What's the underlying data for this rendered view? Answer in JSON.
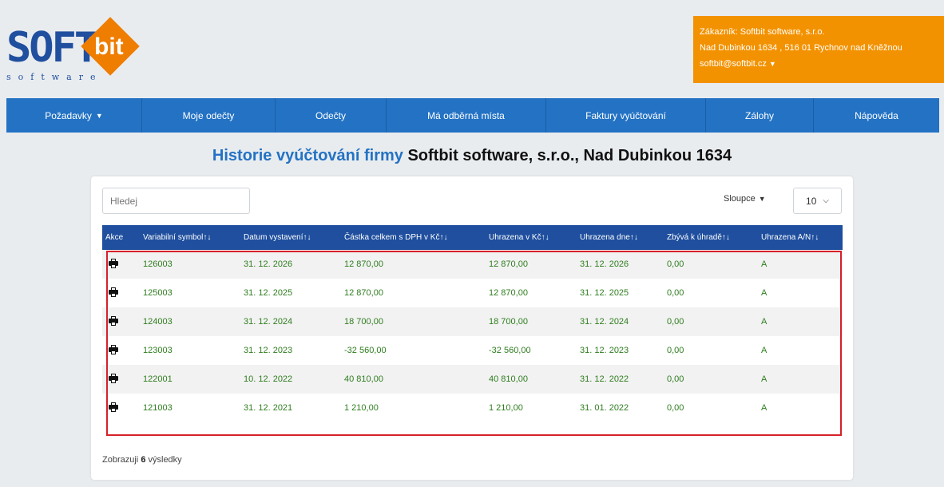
{
  "logo": {
    "soft": "SOFT",
    "bit": "bit",
    "software": "software"
  },
  "customer": {
    "line1": "Zákazník: Softbit software, s.r.o.",
    "line2": "Nad Dubinkou 1634 , 516 01 Rychnov nad Kněžnou",
    "line3": "softbit@softbit.cz"
  },
  "nav": [
    {
      "label": "Požadavky"
    },
    {
      "label": "Moje odečty"
    },
    {
      "label": "Odečty"
    },
    {
      "label": "Má odběrná místa"
    },
    {
      "label": "Faktury vyúčtování"
    },
    {
      "label": "Zálohy"
    },
    {
      "label": "Nápověda"
    }
  ],
  "title": {
    "blue": "Historie vyúčtování firmy",
    "black": "Softbit software, s.r.o., Nad Dubinkou 1634"
  },
  "search": {
    "placeholder": "Hledej"
  },
  "columns_label": "Sloupce",
  "page_size": "10",
  "table": {
    "headers": [
      "Akce",
      "Variabilní symbol↑↓",
      "Datum vystavení↑↓",
      "Částka celkem s DPH v Kč↑↓",
      "Uhrazena v Kč↑↓",
      "Uhrazena dne↑↓",
      "Zbývá k úhradě↑↓",
      "Uhrazena A/N↑↓"
    ],
    "rows": [
      [
        "126003",
        "31. 12. 2026",
        "12 870,00",
        "12 870,00",
        "31. 12. 2026",
        "0,00",
        "A"
      ],
      [
        "125003",
        "31. 12. 2025",
        "12 870,00",
        "12 870,00",
        "31. 12. 2025",
        "0,00",
        "A"
      ],
      [
        "124003",
        "31. 12. 2024",
        "18 700,00",
        "18 700,00",
        "31. 12. 2024",
        "0,00",
        "A"
      ],
      [
        "123003",
        "31. 12. 2023",
        "-32 560,00",
        "-32 560,00",
        "31. 12. 2023",
        "0,00",
        "A"
      ],
      [
        "122001",
        "10. 12. 2022",
        "40 810,00",
        "40 810,00",
        "31. 12. 2022",
        "0,00",
        "A"
      ],
      [
        "121003",
        "31. 12. 2021",
        "1 210,00",
        "1 210,00",
        "31. 01. 2022",
        "0,00",
        "A"
      ]
    ]
  },
  "footer": {
    "prefix": "Zobrazuji",
    "count": "6",
    "suffix": "výsledky"
  },
  "colors": {
    "nav": "#2372c4",
    "header": "#1f4f9e",
    "accent": "#f39200",
    "value": "#2e7d1e",
    "highlight": "#d6202a"
  }
}
